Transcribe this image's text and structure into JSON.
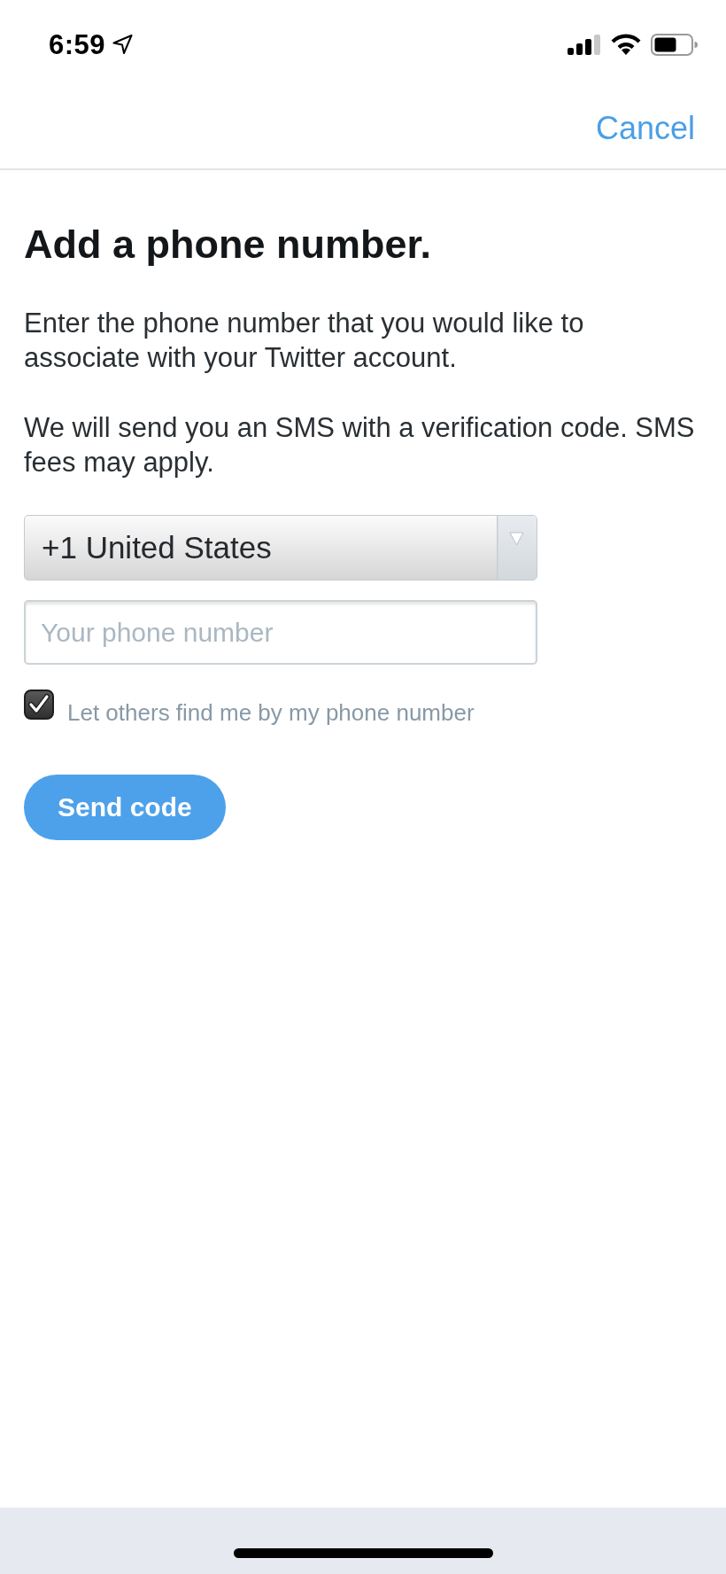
{
  "status_bar": {
    "time": "6:59"
  },
  "nav_bar": {
    "cancel": "Cancel"
  },
  "title": "Add a phone number.",
  "paragraphs": [
    "Enter the phone number that you would like to associate with your Twitter account.",
    "We will send you an SMS with a verification code. SMS fees may apply."
  ],
  "country_select": {
    "value": "+1 United States"
  },
  "phone_field": {
    "placeholder": "Your phone number"
  },
  "discoverable_checkbox": {
    "label": "Let others find me by my phone number",
    "checked": true
  },
  "send_button": {
    "label": "Send code"
  }
}
